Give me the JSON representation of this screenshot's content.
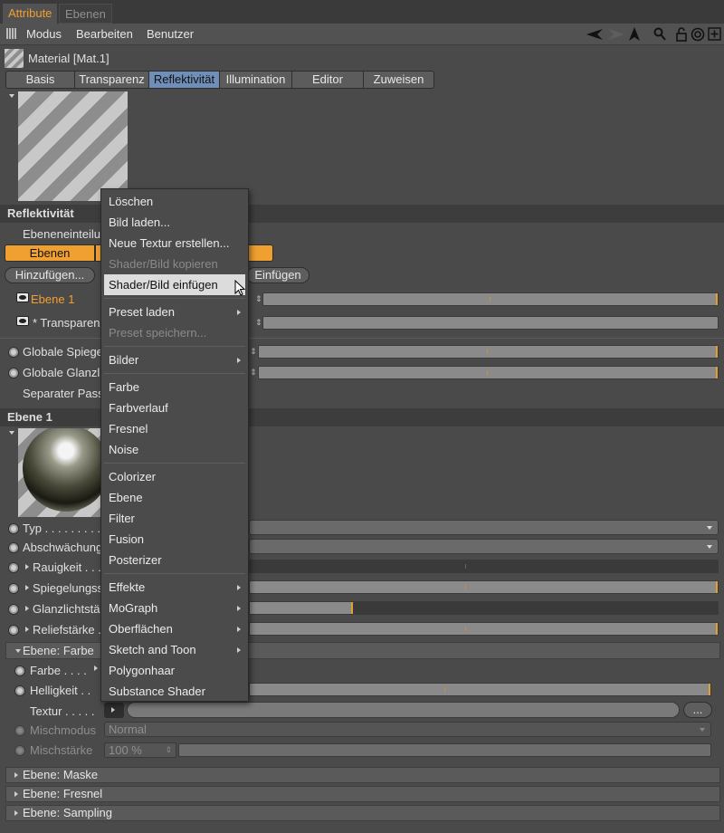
{
  "tabs": [
    "Attribute",
    "Ebenen"
  ],
  "menu": [
    "Modus",
    "Bearbeiten",
    "Benutzer"
  ],
  "toolbar_icons": [
    "arrow-back-icon",
    "arrow-forward-icon",
    "cursor-icon",
    "search-icon",
    "lock-icon",
    "target-icon",
    "add-icon"
  ],
  "material_title": "Material [Mat.1]",
  "material_tabs": [
    "Basis",
    "Transparenz",
    "Reflektivität",
    "Illumination",
    "Editor",
    "Zuweisen"
  ],
  "active_material_tab": "Reflektivität",
  "reflect": {
    "section_title": "Reflektivität",
    "ebeneneinteilung": "Ebeneneinteilu",
    "ebenen_tab": "Ebenen",
    "add_button": "Hinzufügen...",
    "paste_button": "Einfügen",
    "layers": [
      "Ebene 1",
      "* Transparenz"
    ],
    "globale_spiegel": "Globale Spiege",
    "globale_glanz": "Globale Glanzli",
    "separater_pass": "Separater Pass"
  },
  "ebene1": {
    "section_title": "Ebene 1",
    "typ": "Typ . . . . . . . . .",
    "abschwaechung": "Abschwächung",
    "rauigkeit": "Rauigkeit . . .",
    "spiegelung": "Spiegelungss",
    "glanzlicht": "Glanzlichtstä",
    "relief": "Reliefstärke . .",
    "sub_farbe": "Ebene: Farbe",
    "farbe": "Farbe . . . .",
    "helligkeit": "Helligkeit . .",
    "textur": "Textur . . . . .",
    "textur_button": "...",
    "mischmodus": "Mischmodus",
    "mischmodus_value": "Normal",
    "mischstaerke": "Mischstärke",
    "mischstaerke_value": "100 %",
    "glanz_value": 0.22
  },
  "collapsed_sections": [
    "Ebene: Maske",
    "Ebene: Fresnel",
    "Ebene: Sampling"
  ],
  "context_menu": {
    "groups": [
      [
        {
          "label": "Löschen",
          "enabled": true
        },
        {
          "label": "Bild laden...",
          "enabled": true
        },
        {
          "label": "Neue Textur erstellen...",
          "enabled": true
        },
        {
          "label": "Shader/Bild kopieren",
          "enabled": false
        },
        {
          "label": "Shader/Bild einfügen",
          "enabled": true,
          "hover": true
        }
      ],
      [
        {
          "label": "Preset laden",
          "enabled": true,
          "submenu": true
        },
        {
          "label": "Preset speichern...",
          "enabled": false
        }
      ],
      [
        {
          "label": "Bilder",
          "enabled": true,
          "submenu": true
        }
      ],
      [
        {
          "label": "Farbe",
          "enabled": true
        },
        {
          "label": "Farbverlauf",
          "enabled": true
        },
        {
          "label": "Fresnel",
          "enabled": true
        },
        {
          "label": "Noise",
          "enabled": true
        }
      ],
      [
        {
          "label": "Colorizer",
          "enabled": true
        },
        {
          "label": "Ebene",
          "enabled": true
        },
        {
          "label": "Filter",
          "enabled": true
        },
        {
          "label": "Fusion",
          "enabled": true
        },
        {
          "label": "Posterizer",
          "enabled": true
        }
      ],
      [
        {
          "label": "Effekte",
          "enabled": true,
          "submenu": true
        },
        {
          "label": "MoGraph",
          "enabled": true,
          "submenu": true
        },
        {
          "label": "Oberflächen",
          "enabled": true,
          "submenu": true
        },
        {
          "label": "Sketch and Toon",
          "enabled": true,
          "submenu": true
        },
        {
          "label": "Polygonhaar",
          "enabled": true
        },
        {
          "label": "Substance Shader",
          "enabled": true
        }
      ]
    ]
  },
  "colors": {
    "accent": "#f0a030",
    "active_tab": "#6f8fb8",
    "panel": "#4a4a4a"
  }
}
